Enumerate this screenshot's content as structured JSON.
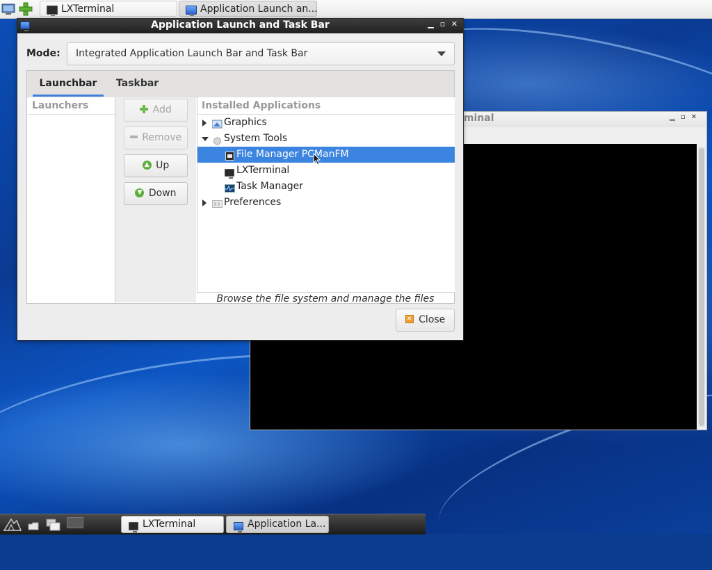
{
  "top_panel": {
    "tasks": [
      {
        "label": "LXTerminal",
        "icon": "terminal-icon"
      },
      {
        "label": "Application Launch an...",
        "icon": "app-window-icon"
      }
    ]
  },
  "terminal_window": {
    "title_fragment": "rminal"
  },
  "dialog": {
    "title": "Application Launch and Task Bar",
    "mode_label": "Mode:",
    "mode_value": "Integrated Application Launch Bar and Task Bar",
    "tabs": [
      {
        "label": "Launchbar",
        "active": true
      },
      {
        "label": "Taskbar",
        "active": false
      }
    ],
    "launchers_header": "Launchers",
    "buttons": {
      "add": "Add",
      "remove": "Remove",
      "up": "Up",
      "down": "Down"
    },
    "installed_header": "Installed Applications",
    "tree": [
      {
        "label": "Graphics",
        "level": 0,
        "expanded": false,
        "icon": "graphics-icon"
      },
      {
        "label": "System Tools",
        "level": 0,
        "expanded": true,
        "icon": "system-tools-icon"
      },
      {
        "label": "File Manager PCManFM",
        "level": 1,
        "selected": true,
        "icon": "file-manager-icon"
      },
      {
        "label": "LXTerminal",
        "level": 1,
        "icon": "terminal-icon"
      },
      {
        "label": "Task Manager",
        "level": 1,
        "icon": "task-manager-icon"
      },
      {
        "label": "Preferences",
        "level": 0,
        "expanded": false,
        "icon": "preferences-icon"
      }
    ],
    "description": "Browse the file system and manage the files",
    "close_label": "Close"
  },
  "bottom_panel": {
    "tasks": [
      {
        "label": "LXTerminal",
        "icon": "terminal-icon"
      },
      {
        "label": "Application La...",
        "icon": "app-window-icon"
      }
    ]
  }
}
